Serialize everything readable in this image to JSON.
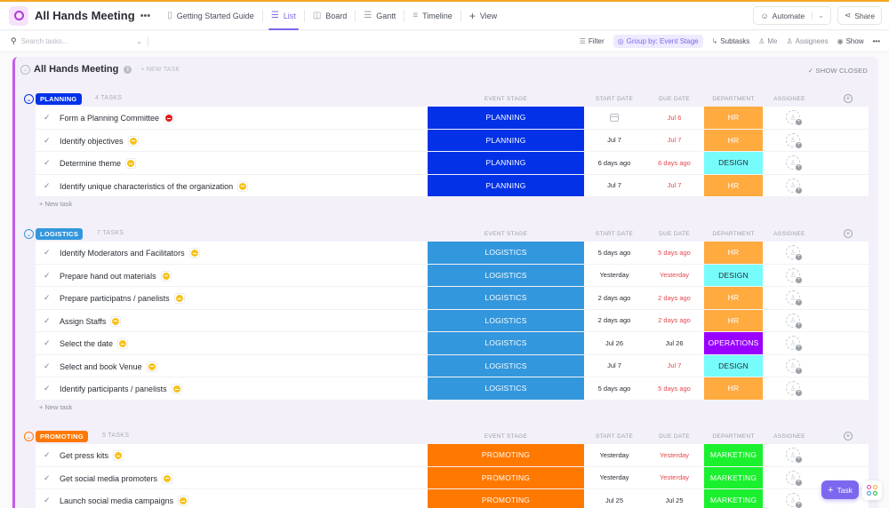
{
  "header": {
    "title": "All Hands Meeting",
    "tabs": [
      {
        "label": "Getting Started Guide",
        "icon": "doc-icon",
        "active": false
      },
      {
        "label": "List",
        "icon": "list-icon",
        "active": true
      },
      {
        "label": "Board",
        "icon": "board-icon",
        "active": false
      },
      {
        "label": "Gantt",
        "icon": "gantt-icon",
        "active": false
      },
      {
        "label": "Timeline",
        "icon": "timeline-icon",
        "active": false
      },
      {
        "label": "View",
        "icon": "plus-icon",
        "active": false
      }
    ],
    "automate_label": "Automate",
    "share_label": "Share"
  },
  "toolbar": {
    "search_placeholder": "Search tasks...",
    "filter_label": "Filter",
    "group_by_label": "Group by: Event Stage",
    "subtasks_label": "Subtasks",
    "me_label": "Me",
    "assignees_label": "Assignees",
    "show_label": "Show"
  },
  "list": {
    "title": "All Hands Meeting",
    "new_task_label": "+ NEW TASK",
    "show_closed_label": "SHOW CLOSED",
    "group_new_task_label": "+ New task",
    "columns": {
      "event_stage": "EVENT STAGE",
      "start_date": "START DATE",
      "due_date": "DUE DATE",
      "department": "DEPARTMENT",
      "assignee": "ASSIGNEE"
    }
  },
  "colors": {
    "accent": "#7b68ee",
    "overdue": "#e5484d",
    "priority_normal": "#f8c21b",
    "priority_urgent": "#e31c1c",
    "dept_HR": "#ffab40",
    "dept_DESIGN": "#76fcfb",
    "dept_OPERATIONS": "#9a00ff",
    "dept_MARKETING": "#1bf02e"
  },
  "groups": [
    {
      "name": "PLANNING",
      "count_label": "4 TASKS",
      "color": "#0231e8",
      "tasks": [
        {
          "name": "Form a Planning Committee",
          "priority": "urgent",
          "stage": "PLANNING",
          "start": "",
          "due": "Jul 6",
          "due_overdue": true,
          "dept": "HR"
        },
        {
          "name": "Identify objectives",
          "priority": "normal",
          "stage": "PLANNING",
          "start": "Jul 7",
          "due": "Jul 7",
          "due_overdue": true,
          "dept": "HR"
        },
        {
          "name": "Determine theme",
          "priority": "normal",
          "stage": "PLANNING",
          "start": "6 days ago",
          "due": "6 days ago",
          "due_overdue": true,
          "dept": "DESIGN"
        },
        {
          "name": "Identify unique characteristics of the organization",
          "priority": "normal",
          "stage": "PLANNING",
          "start": "Jul 7",
          "due": "Jul 7",
          "due_overdue": true,
          "dept": "HR"
        }
      ]
    },
    {
      "name": "LOGISTICS",
      "count_label": "7 TASKS",
      "color": "#3397dd",
      "tasks": [
        {
          "name": "Identify Moderators and Facilitators",
          "priority": "normal",
          "stage": "LOGISTICS",
          "start": "5 days ago",
          "due": "5 days ago",
          "due_overdue": true,
          "dept": "HR"
        },
        {
          "name": "Prepare hand out materials",
          "priority": "normal",
          "stage": "LOGISTICS",
          "start": "Yesterday",
          "due": "Yesterday",
          "due_overdue": true,
          "dept": "DESIGN"
        },
        {
          "name": "Prepare participatns / panelists",
          "priority": "normal",
          "stage": "LOGISTICS",
          "start": "2 days ago",
          "due": "2 days ago",
          "due_overdue": true,
          "dept": "HR"
        },
        {
          "name": "Assign Staffs",
          "priority": "normal",
          "stage": "LOGISTICS",
          "start": "2 days ago",
          "due": "2 days ago",
          "due_overdue": true,
          "dept": "HR"
        },
        {
          "name": "Select the date",
          "priority": "normal",
          "stage": "LOGISTICS",
          "start": "Jul 26",
          "due": "Jul 26",
          "due_overdue": false,
          "dept": "OPERATIONS"
        },
        {
          "name": "Select and book Venue",
          "priority": "normal",
          "stage": "LOGISTICS",
          "start": "Jul 7",
          "due": "Jul 7",
          "due_overdue": true,
          "dept": "DESIGN"
        },
        {
          "name": "Identify participants / panelists",
          "priority": "normal",
          "stage": "LOGISTICS",
          "start": "5 days ago",
          "due": "5 days ago",
          "due_overdue": true,
          "dept": "HR"
        }
      ]
    },
    {
      "name": "PROMOTING",
      "count_label": "5 TASKS",
      "color": "#ff7800",
      "tasks": [
        {
          "name": "Get press kits",
          "priority": "normal",
          "stage": "PROMOTING",
          "start": "Yesterday",
          "due": "Yesterday",
          "due_overdue": true,
          "dept": "MARKETING"
        },
        {
          "name": "Get social media promoters",
          "priority": "normal",
          "stage": "PROMOTING",
          "start": "Yesterday",
          "due": "Yesterday",
          "due_overdue": true,
          "dept": "MARKETING"
        },
        {
          "name": "Launch social media campaigns",
          "priority": "normal",
          "stage": "PROMOTING",
          "start": "Jul 25",
          "due": "Jul 25",
          "due_overdue": false,
          "dept": "MARKETING"
        }
      ]
    }
  ],
  "fab": {
    "label": "Task"
  }
}
